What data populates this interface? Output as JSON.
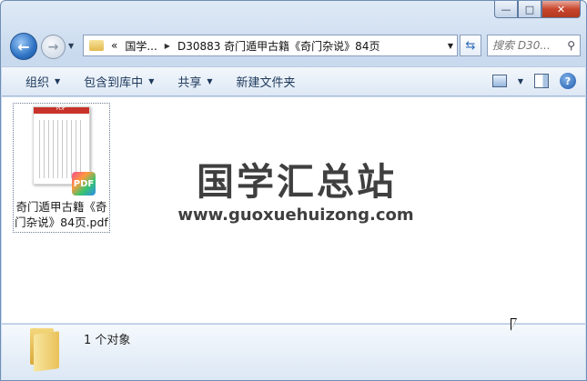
{
  "nav": {
    "address_path": [
      "«",
      "国学...",
      "D30883 奇门遁甲古籍《奇门杂说》84页"
    ],
    "search_placeholder": "搜索 D30...",
    "back_glyph": "←",
    "forward_glyph": "→"
  },
  "toolbar": {
    "organize": "组织",
    "include_in_library": "包含到库中",
    "share": "共享",
    "new_folder": "新建文件夹"
  },
  "files": [
    {
      "name_line1": "奇门遁甲古籍《奇",
      "name_line2": "门杂说》84页.pdf",
      "badge": "PDF",
      "thumb_label": "PDF"
    }
  ],
  "watermark": {
    "title": "国学汇总站",
    "url": "www.guoxuehuizong.com"
  },
  "status": {
    "count_text": "1 个对象"
  },
  "icons": {
    "view": "view-options-icon",
    "preview_pane": "preview-pane-icon",
    "help": "help-icon",
    "refresh": "refresh-icon",
    "search": "search-icon"
  },
  "colors": {
    "accent": "#2f73c4",
    "close_button": "#c8452d",
    "pdf_red": "#c8322a"
  }
}
